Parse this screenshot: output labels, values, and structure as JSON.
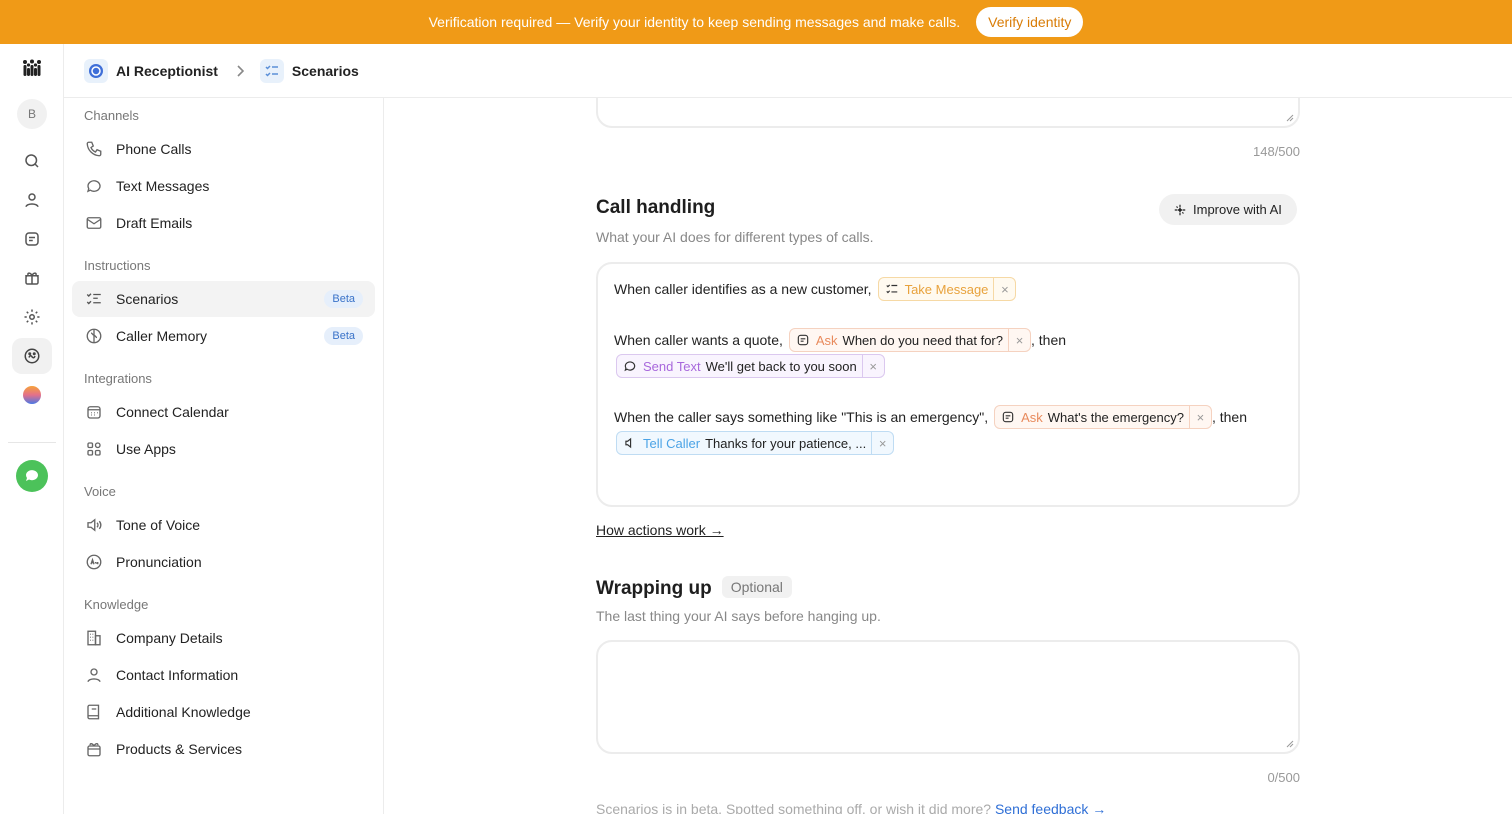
{
  "banner": {
    "text": "Verification required — Verify your identity to keep sending messages and make calls.",
    "button": "Verify identity",
    "color": "#f09a17"
  },
  "rail": {
    "avatar_initial": "B"
  },
  "breadcrumb": {
    "items": [
      "AI Receptionist",
      "Scenarios"
    ]
  },
  "sidebar": {
    "sections": {
      "channels": "Channels",
      "instructions": "Instructions",
      "integrations": "Integrations",
      "voice": "Voice",
      "knowledge": "Knowledge"
    },
    "items": {
      "phone_calls": "Phone Calls",
      "text_messages": "Text Messages",
      "draft_emails": "Draft Emails",
      "scenarios": "Scenarios",
      "caller_memory": "Caller Memory",
      "connect_calendar": "Connect Calendar",
      "use_apps": "Use Apps",
      "tone_of_voice": "Tone of Voice",
      "pronunciation": "Pronunciation",
      "company_details": "Company Details",
      "contact_information": "Contact Information",
      "additional_knowledge": "Additional Knowledge",
      "products_services": "Products & Services"
    },
    "beta_label": "Beta"
  },
  "main": {
    "top_counter": "148/500",
    "call_handling": {
      "title": "Call handling",
      "subtitle": "What your AI does for different types of calls.",
      "improve_button": "Improve with AI",
      "rule1": {
        "text": "When caller identifies as a new customer,",
        "chip_label": "Take Message"
      },
      "rule2": {
        "text": "When caller wants a quote,",
        "chip1_label": "Ask",
        "chip1_value": "When do you need that for?",
        "then": ", then",
        "chip2_label": "Send Text",
        "chip2_value": "We'll get back to you soon"
      },
      "rule3": {
        "text": "When the caller says something like \"This is an emergency\",",
        "chip1_label": "Ask",
        "chip1_value": "What's the emergency?",
        "then": ", then",
        "chip2_label": "Tell Caller",
        "chip2_value": "Thanks for your patience, ..."
      },
      "remove_glyph": "×",
      "link": "How actions work →"
    },
    "wrapping_up": {
      "title": "Wrapping up",
      "badge": "Optional",
      "subtitle": "The last thing your AI says before hanging up.",
      "counter": "0/500"
    },
    "footer": {
      "text": "Scenarios is in beta. Spotted something off, or wish it did more?",
      "link": "Send feedback →"
    }
  }
}
